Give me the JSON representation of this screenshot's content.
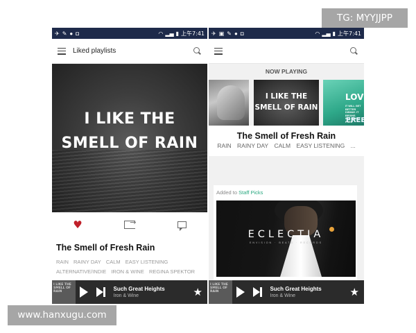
{
  "status_bar": {
    "time_left": "上午7:41",
    "time_right": "上午7:41",
    "signal_glyphs": "☉ .❘ ▮"
  },
  "left_screen": {
    "appbar_title": "Liked playlists",
    "cover_text_line1": "I LIKE THE",
    "cover_text_line2": "SMELL OF RAIN",
    "playlist_title": "The Smell of Fresh Rain",
    "tags_line1": [
      "RAIN",
      "RAINY DAY",
      "CALM",
      "EASY LISTENING"
    ],
    "tags_line2": [
      "ALTERNATIVE/INDIE",
      "IRON & WINE",
      "REGINA SPEKTOR"
    ]
  },
  "right_screen": {
    "now_playing_label": "NOW PLAYING",
    "carousel_center_line1": "I LIKE THE",
    "carousel_center_line2": "SMELL OF RAIN",
    "carousel_right_word1": "LOVE",
    "carousel_right_small": "IT WILL GET BETTER\nDISMAY. IT BEGINS\nIN A HEART\nFREE",
    "carousel_right_word2": "FREE",
    "playlist_title": "The Smell of Fresh Rain",
    "tags": [
      "RAIN",
      "RAINY DAY",
      "CALM",
      "EASY LISTENING",
      "..."
    ],
    "staff_prefix": "Added to",
    "staff_link": "Staff Picks",
    "featured_title": "ECLECTIA",
    "featured_subtitle": "ENVISION · BEATS · RECORDS"
  },
  "mini_player": {
    "thumb_text": "I LIKE THE SMELL OF RAIN",
    "track_title": "Such Great Heights",
    "track_artist": "Iron & Wine"
  },
  "watermarks": {
    "top_right": "TG: MYYJJPP",
    "bottom_left": "www.hanxugu.com"
  },
  "colors": {
    "status_bar": "#1e2a4a",
    "heart": "#c0202a",
    "staff_accent": "#2aa880",
    "mini_player": "#2b2b2b"
  }
}
